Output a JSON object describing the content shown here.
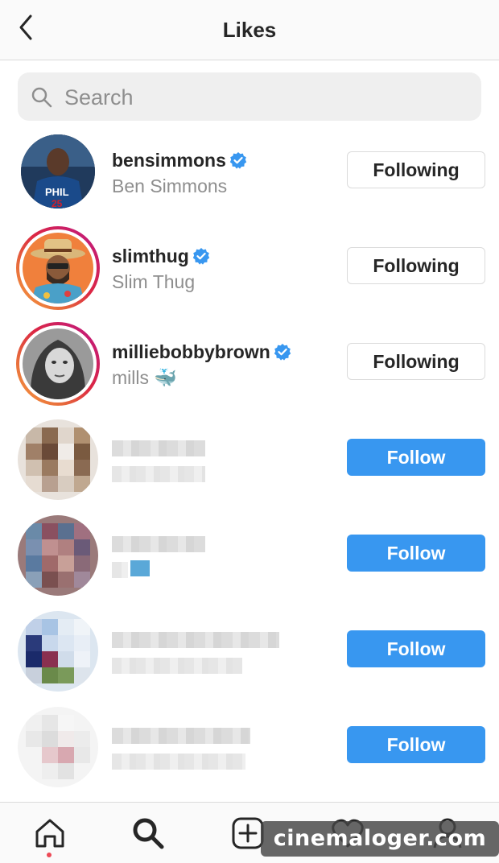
{
  "header": {
    "title": "Likes"
  },
  "search": {
    "placeholder": "Search",
    "value": ""
  },
  "users": [
    {
      "username": "bensimmons",
      "full_name": "Ben Simmons",
      "verified": true,
      "button": "Following"
    },
    {
      "username": "slimthug",
      "full_name": "Slim Thug",
      "verified": true,
      "button": "Following"
    },
    {
      "username": "milliebobbybrown",
      "full_name": "mills 🐳",
      "verified": true,
      "button": "Following"
    },
    {
      "button": "Follow"
    },
    {
      "button": "Follow"
    },
    {
      "button": "Follow"
    },
    {
      "button": "Follow"
    }
  ],
  "watermark": "cinemaloger.com",
  "colors": {
    "follow_blue": "#3897f0",
    "verified_blue": "#3897f0",
    "notification_dot": "#ed4956",
    "text_primary": "#262626",
    "text_secondary": "#8e8e8e"
  },
  "icons": {
    "back": "chevron-left-icon",
    "search": "search-icon",
    "verified": "verified-badge-icon",
    "tabs": [
      "home-icon",
      "search-icon",
      "add-post-icon",
      "heart-icon",
      "profile-icon"
    ]
  }
}
